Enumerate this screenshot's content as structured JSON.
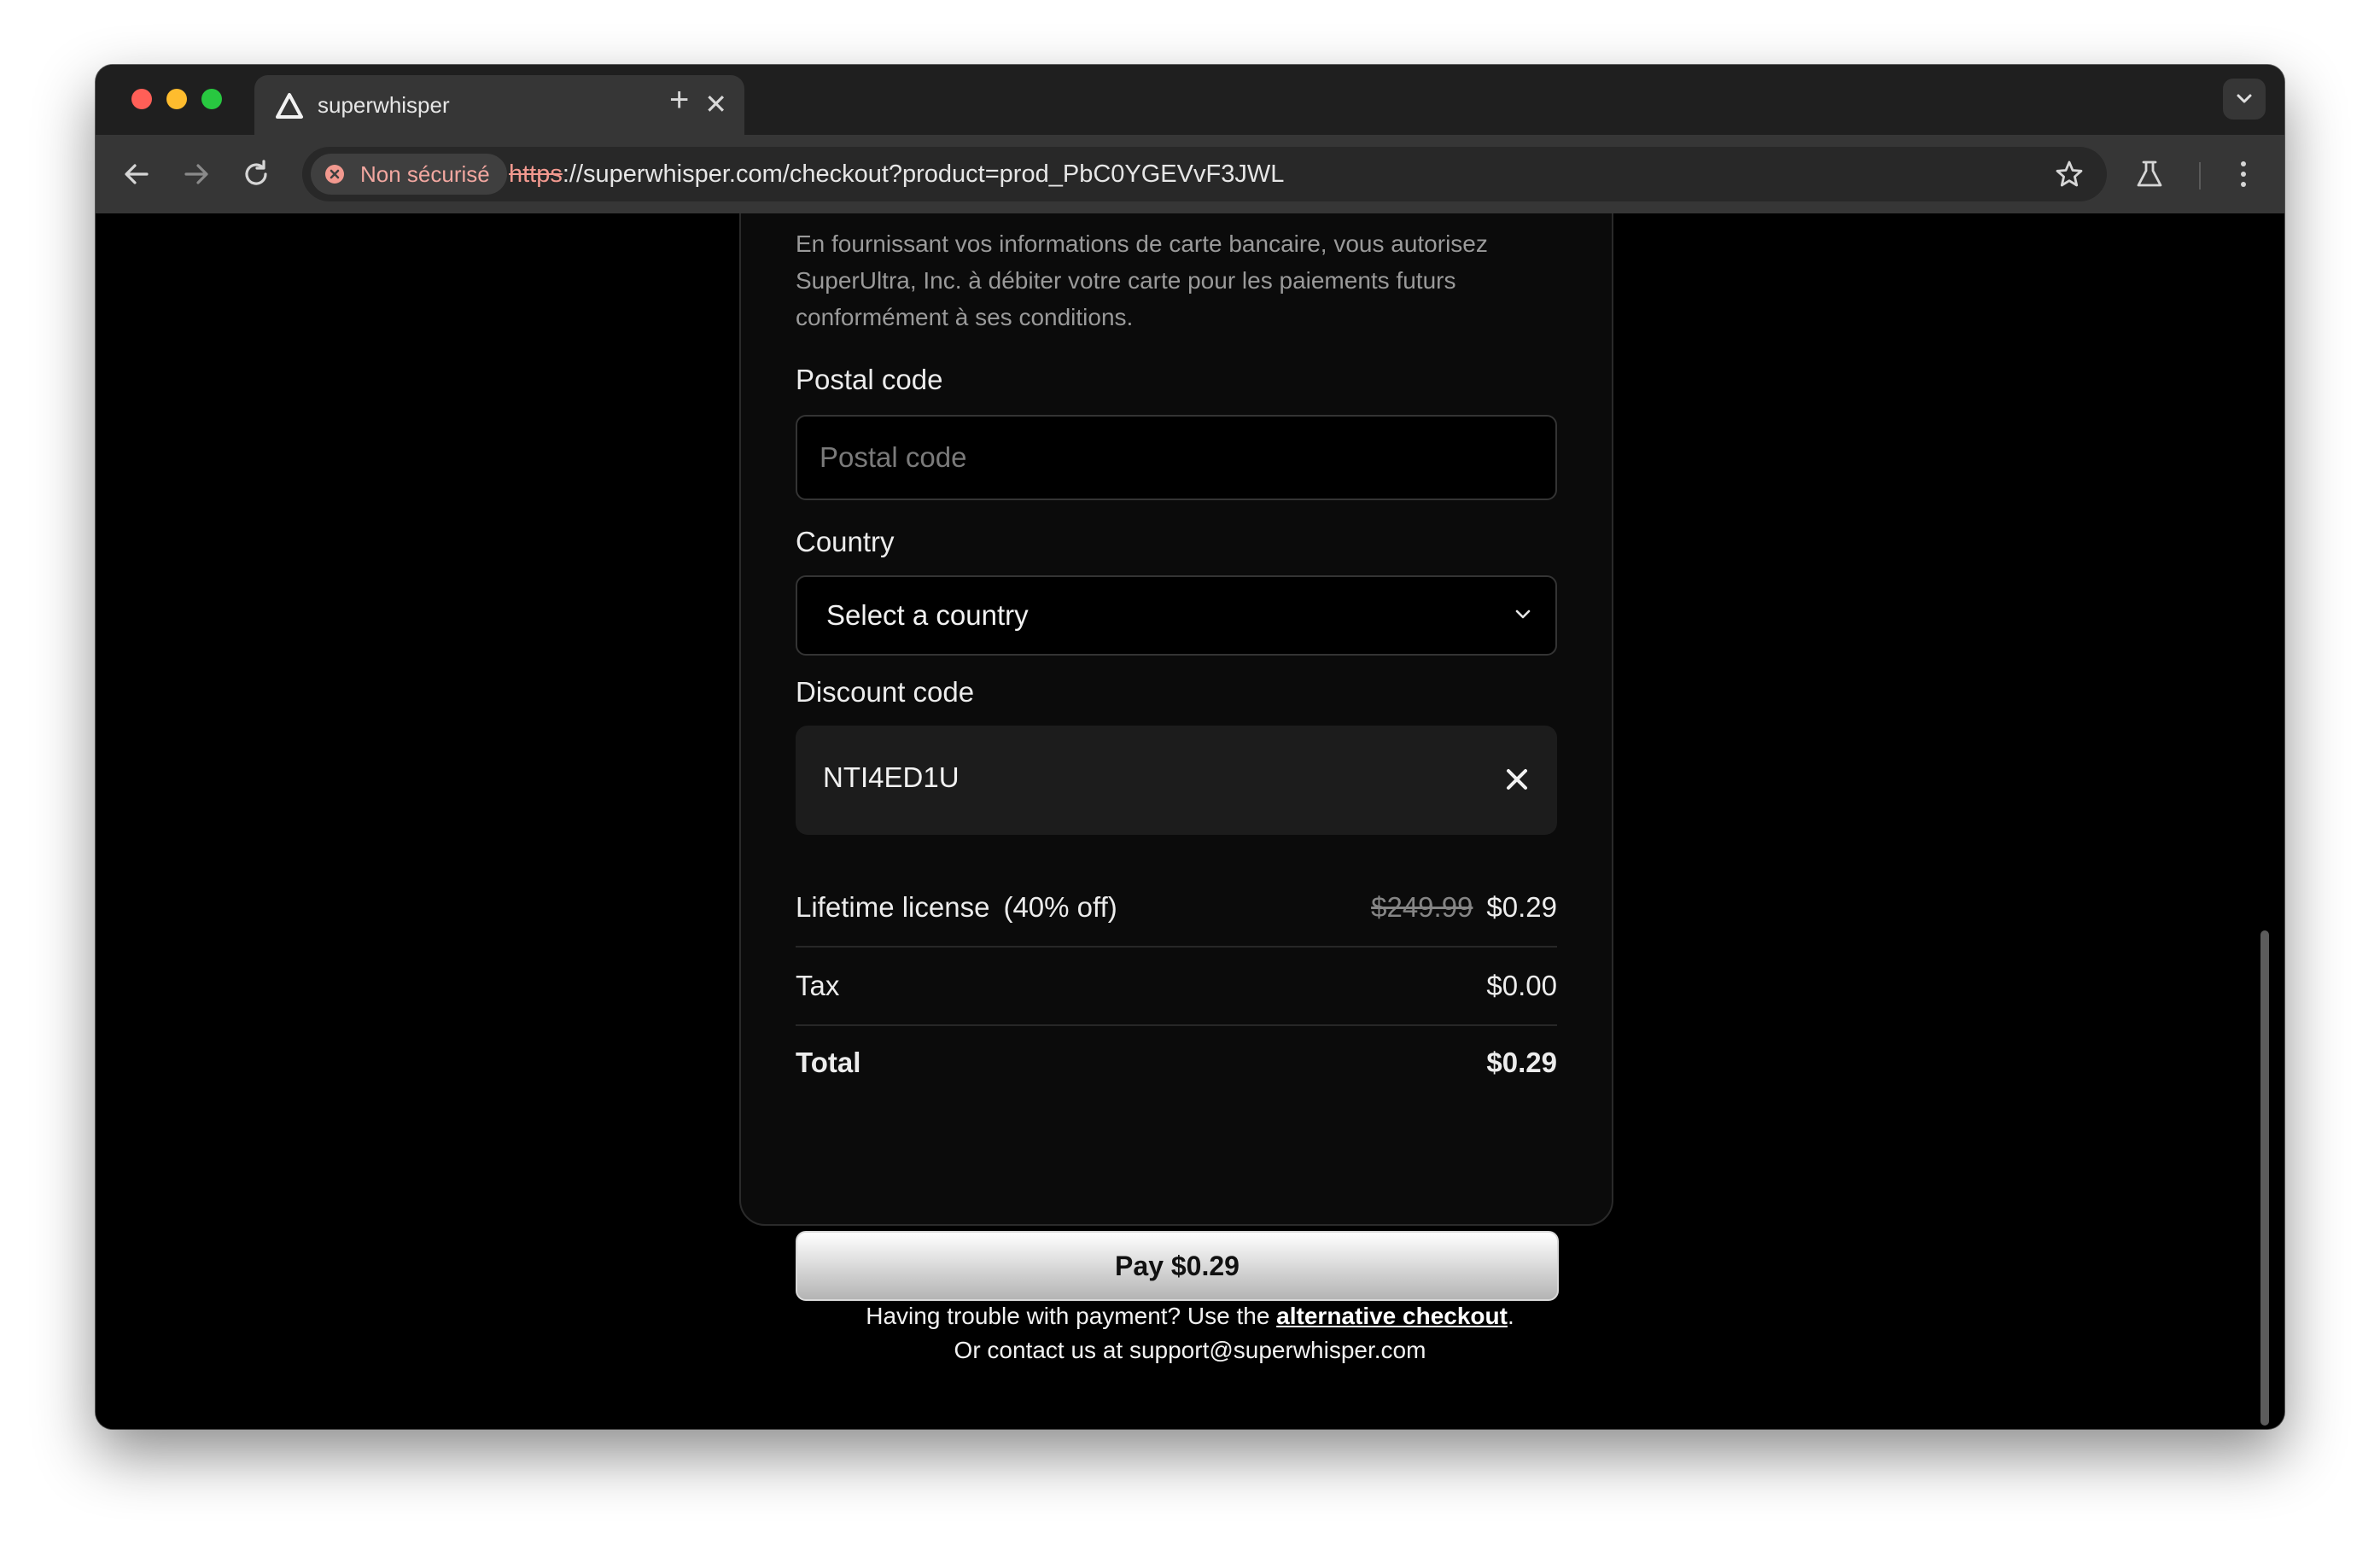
{
  "browser": {
    "tab": {
      "title": "superwhisper"
    },
    "security_label": "Non sécurisé",
    "url": {
      "scheme": "https",
      "rest": "://superwhisper.com/checkout?product=prod_PbC0YGEVvF3JWL"
    }
  },
  "form": {
    "consent_text": "En fournissant vos informations de carte bancaire, vous autorisez SuperUltra, Inc. à débiter votre carte pour les paiements futurs conformément à ses conditions.",
    "postal": {
      "label": "Postal code",
      "placeholder": "Postal code",
      "value": ""
    },
    "country": {
      "label": "Country",
      "value": "Select a country"
    },
    "discount": {
      "label": "Discount code",
      "value": "NTI4ED1U"
    }
  },
  "summary": {
    "items": [
      {
        "label": "Lifetime license",
        "discount_note": "(40% off)",
        "original_price": "$249.99",
        "price": "$0.29"
      },
      {
        "label": "Tax",
        "price": "$0.00"
      }
    ],
    "total": {
      "label": "Total",
      "price": "$0.29"
    }
  },
  "pay_button": {
    "label": "Pay $0.29"
  },
  "help": {
    "line1_prefix": "Having trouble with payment? Use the ",
    "link": "alternative checkout",
    "line1_suffix": ".",
    "line2": "Or contact us at support@superwhisper.com"
  }
}
